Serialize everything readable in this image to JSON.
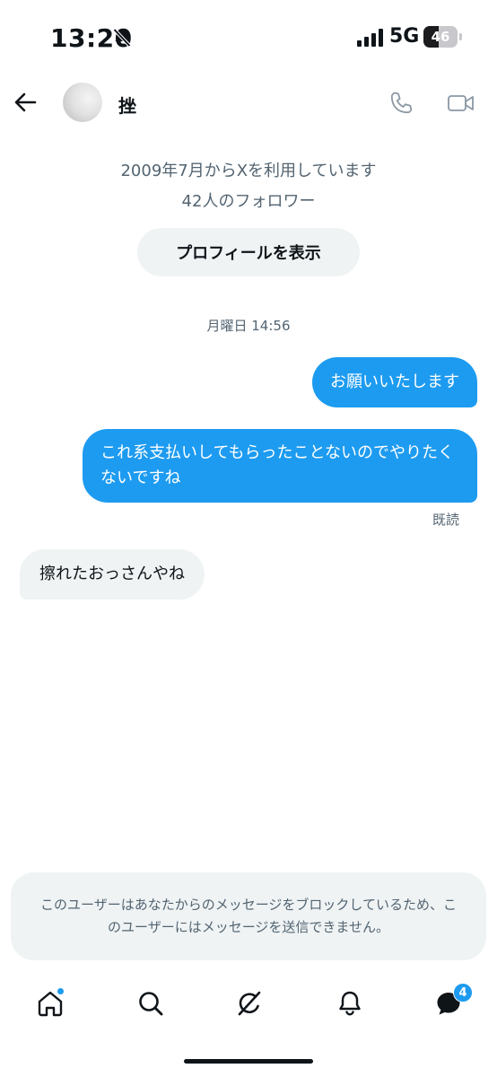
{
  "status_bar": {
    "time": "13:20",
    "network": "5G",
    "battery_level": "46",
    "battery_fraction": 0.46,
    "icons": [
      "bell-slash-icon",
      "signal-icon",
      "battery-icon"
    ]
  },
  "header": {
    "contact_name": "挫",
    "icons": [
      "back-arrow-icon",
      "phone-icon",
      "video-camera-icon"
    ]
  },
  "profile": {
    "joined": "2009年7月からXを利用しています",
    "followers": "42人のフォロワー",
    "view_profile_label": "プロフィールを表示"
  },
  "conversation": {
    "day_stamp": "月曜日 14:56",
    "messages": [
      {
        "direction": "outgoing",
        "text": "お願いいたします"
      },
      {
        "direction": "outgoing",
        "text": "これ系支払いしてもらったことないのでやりたくないですね"
      },
      {
        "direction": "incoming",
        "text": "擦れたおっさんやね"
      }
    ],
    "read_receipt": "既読"
  },
  "blocked_notice": {
    "text": "このユーザーはあなたからのメッセージをブロックしているため、このユーザーにはメッセージを送信できません。"
  },
  "bottom_nav": {
    "items": [
      "home-icon",
      "search-icon",
      "grok-icon",
      "bell-icon",
      "messages-icon"
    ],
    "messages_badge": "4"
  },
  "colors": {
    "accent": "#1d9bf0",
    "incoming_bubble": "#eff3f4",
    "secondary_text": "#536471",
    "primary_text": "#0f1419"
  }
}
